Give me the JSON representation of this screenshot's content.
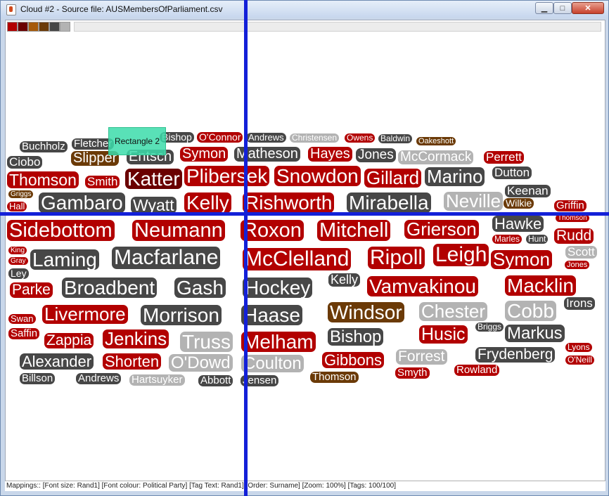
{
  "window": {
    "title": "Cloud #2 - Source file: AUSMembersOfParliament.csv",
    "minimize": "▁",
    "maximize": "□",
    "close": "✕"
  },
  "palette": [
    "#b20000",
    "#6a0000",
    "#a65a0a",
    "#6b3a07",
    "#474747",
    "#b3b3b3"
  ],
  "overlay": {
    "rectangle_label": "Rectangle 2"
  },
  "tags": [
    {
      "text": "Buchholz",
      "color": "dark"
    },
    {
      "text": "Fletcher",
      "color": "dark"
    },
    {
      "text": "Bishop",
      "color": "dark"
    },
    {
      "text": "O'Connor",
      "color": "red"
    },
    {
      "text": "Andrews",
      "color": "dark"
    },
    {
      "text": "Christensen",
      "color": "grey"
    },
    {
      "text": "Owens",
      "color": "red"
    },
    {
      "text": "Baldwin",
      "color": "dark"
    },
    {
      "text": "Oakeshott",
      "color": "brown"
    },
    {
      "text": "Ciobo",
      "color": "dark"
    },
    {
      "text": "Slipper",
      "color": "brown"
    },
    {
      "text": "Entsch",
      "color": "dark"
    },
    {
      "text": "Symon",
      "color": "red"
    },
    {
      "text": "Matheson",
      "color": "dark"
    },
    {
      "text": "Hayes",
      "color": "red"
    },
    {
      "text": "Jones",
      "color": "dark"
    },
    {
      "text": "McCormack",
      "color": "grey"
    },
    {
      "text": "Perrett",
      "color": "red"
    },
    {
      "text": "Thomson",
      "color": "red"
    },
    {
      "text": "Smith",
      "color": "red"
    },
    {
      "text": "Katter",
      "color": "maroon"
    },
    {
      "text": "Plibersek",
      "color": "red"
    },
    {
      "text": "Snowdon",
      "color": "red"
    },
    {
      "text": "Gillard",
      "color": "red"
    },
    {
      "text": "Marino",
      "color": "dark"
    },
    {
      "text": "Dutton",
      "color": "dark"
    },
    {
      "text": "Griggs",
      "color": "brown"
    },
    {
      "text": "Keenan",
      "color": "dark"
    },
    {
      "text": "Hall",
      "color": "red"
    },
    {
      "text": "Gambaro",
      "color": "dark"
    },
    {
      "text": "Wyatt",
      "color": "dark"
    },
    {
      "text": "Kelly",
      "color": "red"
    },
    {
      "text": "Rishworth",
      "color": "red"
    },
    {
      "text": "Mirabella",
      "color": "dark"
    },
    {
      "text": "Neville",
      "color": "grey"
    },
    {
      "text": "Wilkie",
      "color": "brown"
    },
    {
      "text": "Griffin",
      "color": "red"
    },
    {
      "text": "Thomson",
      "color": "red"
    },
    {
      "text": "Sidebottom",
      "color": "red"
    },
    {
      "text": "Neumann",
      "color": "red"
    },
    {
      "text": "Roxon",
      "color": "red"
    },
    {
      "text": "Mitchell",
      "color": "red"
    },
    {
      "text": "Grierson",
      "color": "red"
    },
    {
      "text": "Hawke",
      "color": "dark"
    },
    {
      "text": "Rudd",
      "color": "red"
    },
    {
      "text": "Marles",
      "color": "red"
    },
    {
      "text": "Hunt",
      "color": "dark"
    },
    {
      "text": "King",
      "color": "red"
    },
    {
      "text": "Scott",
      "color": "grey"
    },
    {
      "text": "Gray",
      "color": "red"
    },
    {
      "text": "Laming",
      "color": "dark"
    },
    {
      "text": "Macfarlane",
      "color": "dark"
    },
    {
      "text": "McClelland",
      "color": "red"
    },
    {
      "text": "Ripoll",
      "color": "red"
    },
    {
      "text": "Leigh",
      "color": "red"
    },
    {
      "text": "Symon",
      "color": "red"
    },
    {
      "text": "Jones",
      "color": "red"
    },
    {
      "text": "Ley",
      "color": "dark"
    },
    {
      "text": "Kelly",
      "color": "dark"
    },
    {
      "text": "Parke",
      "color": "red"
    },
    {
      "text": "Broadbent",
      "color": "dark"
    },
    {
      "text": "Gash",
      "color": "dark"
    },
    {
      "text": "Hockey",
      "color": "dark"
    },
    {
      "text": "Vamvakinou",
      "color": "red"
    },
    {
      "text": "Macklin",
      "color": "red"
    },
    {
      "text": "Irons",
      "color": "dark"
    },
    {
      "text": "Swan",
      "color": "red"
    },
    {
      "text": "Livermore",
      "color": "red"
    },
    {
      "text": "Morrison",
      "color": "dark"
    },
    {
      "text": "Haase",
      "color": "dark"
    },
    {
      "text": "Windsor",
      "color": "brown"
    },
    {
      "text": "Chester",
      "color": "grey"
    },
    {
      "text": "Cobb",
      "color": "grey"
    },
    {
      "text": "Saffin",
      "color": "red"
    },
    {
      "text": "Briggs",
      "color": "dark"
    },
    {
      "text": "Zappia",
      "color": "red"
    },
    {
      "text": "Jenkins",
      "color": "red"
    },
    {
      "text": "Truss",
      "color": "grey"
    },
    {
      "text": "Melham",
      "color": "red"
    },
    {
      "text": "Bishop",
      "color": "dark"
    },
    {
      "text": "Husic",
      "color": "red"
    },
    {
      "text": "Markus",
      "color": "dark"
    },
    {
      "text": "Lyons",
      "color": "red"
    },
    {
      "text": "Alexander",
      "color": "dark"
    },
    {
      "text": "Shorten",
      "color": "red"
    },
    {
      "text": "O'Dowd",
      "color": "grey"
    },
    {
      "text": "Coulton",
      "color": "grey"
    },
    {
      "text": "Gibbons",
      "color": "red"
    },
    {
      "text": "Forrest",
      "color": "grey"
    },
    {
      "text": "Frydenberg",
      "color": "dark"
    },
    {
      "text": "O'Neill",
      "color": "red"
    },
    {
      "text": "Billson",
      "color": "dark"
    },
    {
      "text": "Andrews",
      "color": "dark"
    },
    {
      "text": "Hartsuyker",
      "color": "grey"
    },
    {
      "text": "Abbott",
      "color": "dark"
    },
    {
      "text": "Jensen",
      "color": "dark"
    },
    {
      "text": "Thomson",
      "color": "brown"
    },
    {
      "text": "Smyth",
      "color": "red"
    },
    {
      "text": "Rowland",
      "color": "red"
    }
  ],
  "status": {
    "text": "Mappings:: [Font size: Rand1]  [Font colour: Political Party]  [Tag Text: Rand1]  [Order: Surname]  [Zoom: 100%]  [Tags: 100/100]"
  }
}
